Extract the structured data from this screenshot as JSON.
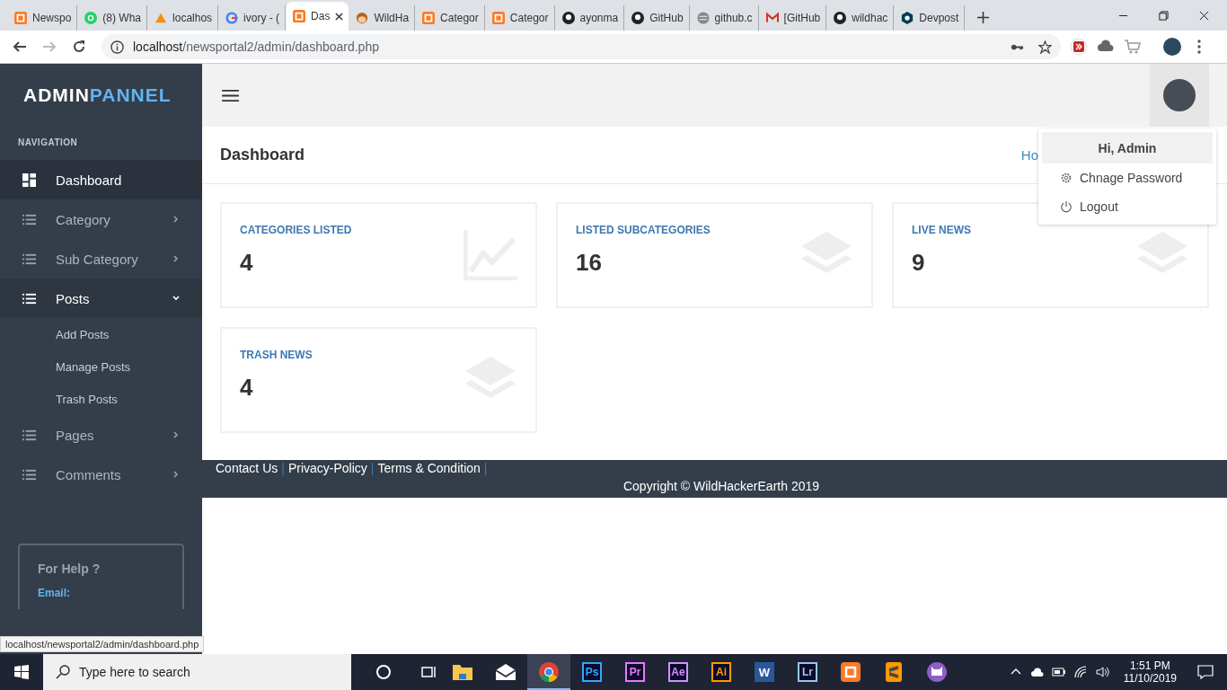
{
  "browser": {
    "tabs": [
      {
        "title": "Newspo",
        "kind": "xampp",
        "selected": false
      },
      {
        "title": "(8) Wha",
        "kind": "whatsapp",
        "selected": false
      },
      {
        "title": "localhos",
        "kind": "pma",
        "selected": false
      },
      {
        "title": "ivory - (",
        "kind": "google",
        "selected": false
      },
      {
        "title": "Das",
        "kind": "xampp",
        "selected": true
      },
      {
        "title": "WildHa",
        "kind": "monkey",
        "selected": false
      },
      {
        "title": "Categor",
        "kind": "xampp",
        "selected": false
      },
      {
        "title": "Categor",
        "kind": "xampp",
        "selected": false
      },
      {
        "title": "ayonma",
        "kind": "github",
        "selected": false
      },
      {
        "title": "GitHub",
        "kind": "github",
        "selected": false
      },
      {
        "title": "github.c",
        "kind": "globe",
        "selected": false
      },
      {
        "title": "[GitHub",
        "kind": "gmail",
        "selected": false
      },
      {
        "title": "wildhac",
        "kind": "github",
        "selected": false
      },
      {
        "title": "Devpost",
        "kind": "devpost",
        "selected": false
      }
    ],
    "url_host": "localhost",
    "url_path": "/newsportal2/admin/dashboard.php",
    "status_url": "localhost/newsportal2/admin/dashboard.php"
  },
  "sidebar": {
    "logo_first": "ADMIN",
    "logo_second": "PANNEL",
    "section": "NAVIGATION",
    "items": [
      {
        "label": "Dashboard",
        "kind": "dashboard",
        "selected": true,
        "expanded": false
      },
      {
        "label": "Category",
        "kind": "list",
        "selected": false,
        "expanded": false
      },
      {
        "label": "Sub Category",
        "kind": "list",
        "selected": false,
        "expanded": false
      },
      {
        "label": "Posts",
        "kind": "list",
        "selected": false,
        "expanded": true,
        "children": [
          {
            "label": "Add Posts"
          },
          {
            "label": "Manage Posts"
          },
          {
            "label": "Trash Posts"
          }
        ]
      },
      {
        "label": "Pages",
        "kind": "list",
        "selected": false,
        "expanded": false
      },
      {
        "label": "Comments",
        "kind": "list",
        "selected": false,
        "expanded": false
      }
    ],
    "help": {
      "title": "For Help ?",
      "email_label": "Email:"
    }
  },
  "header": {
    "title": "Dashboard",
    "breadcrumb": "Ho"
  },
  "user_menu": {
    "greeting": "Hi, Admin",
    "items": [
      {
        "label": "Chnage Password",
        "kind": "gear"
      },
      {
        "label": "Logout",
        "kind": "power"
      }
    ]
  },
  "cards": [
    {
      "title": "CATEGORIES LISTED",
      "value": "4",
      "kind": "chart"
    },
    {
      "title": "LISTED SUBCATEGORIES",
      "value": "16",
      "kind": "layers"
    },
    {
      "title": "LIVE NEWS",
      "value": "9",
      "kind": "layers"
    },
    {
      "title": "TRASH NEWS",
      "value": "4",
      "kind": "layers"
    }
  ],
  "footer": {
    "links": [
      "Contact Us",
      "Privacy-Policy",
      "Terms & Condition"
    ],
    "separator": "|",
    "copyright": "Copyright © WildHackerEarth 2019"
  },
  "taskbar": {
    "search_placeholder": "Type here to search",
    "apps": [
      {
        "kind": "explorer",
        "selected": false
      },
      {
        "kind": "mail",
        "selected": false
      },
      {
        "kind": "chrome",
        "selected": true
      },
      {
        "kind": "badge",
        "label": "Ps",
        "color": "#31a8ff",
        "selected": false
      },
      {
        "kind": "badge",
        "label": "Pr",
        "color": "#ea77ff",
        "selected": false
      },
      {
        "kind": "badge",
        "label": "Ae",
        "color": "#d291ff",
        "selected": false
      },
      {
        "kind": "badge",
        "label": "Ai",
        "color": "#ff9a00",
        "selected": false
      },
      {
        "kind": "word",
        "label": "W",
        "selected": false
      },
      {
        "kind": "badge",
        "label": "Lr",
        "color": "#9dc5e8",
        "selected": false
      },
      {
        "kind": "xampp",
        "selected": false
      },
      {
        "kind": "sublime",
        "selected": false
      },
      {
        "kind": "cat",
        "selected": false
      }
    ],
    "time": "1:51 PM",
    "date": "11/10/2019"
  }
}
